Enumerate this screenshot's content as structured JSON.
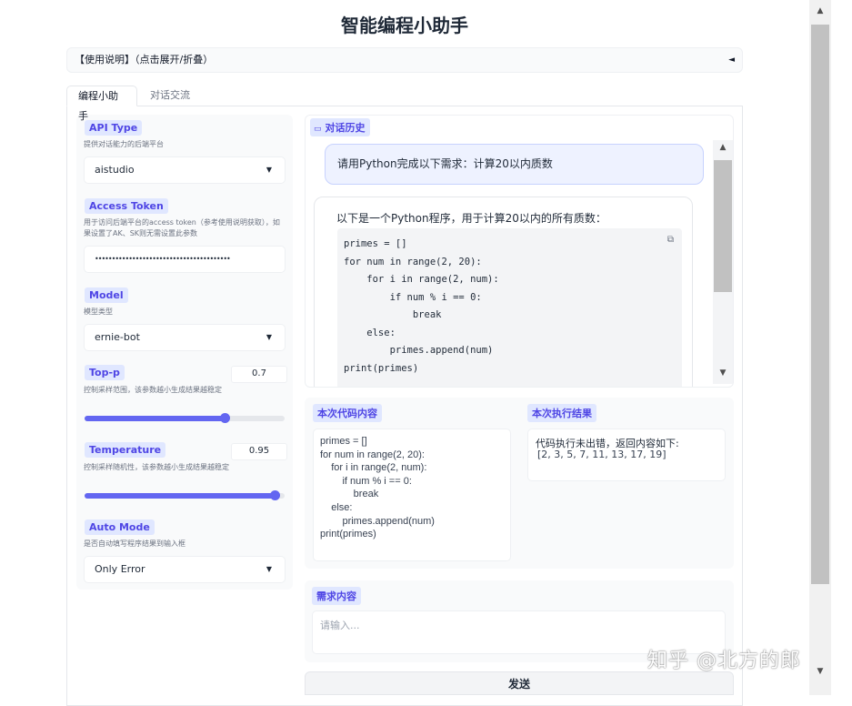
{
  "app": {
    "title": "智能编程小助手"
  },
  "instructions": {
    "label": "【使用说明】（点击展开/折叠）",
    "caret": "◄"
  },
  "tabs": [
    {
      "label": "编程小助手",
      "active": true
    },
    {
      "label": "对话交流",
      "active": false
    }
  ],
  "settings": {
    "api_type": {
      "label": "API Type",
      "hint": "提供对话能力的后端平台",
      "value": "aistudio"
    },
    "access_token": {
      "label": "Access Token",
      "hint": "用于访问后端平台的access token（参考使用说明获取），如果设置了AK、SK则无需设置此参数",
      "value": "••••••••••••••••••••••••••••••••••••••••"
    },
    "model": {
      "label": "Model",
      "hint": "模型类型",
      "value": "ernie-bot"
    },
    "top_p": {
      "label": "Top-p",
      "hint": "控制采样范围，该参数越小生成结果越稳定",
      "value": "0.7",
      "fraction": 0.7
    },
    "temperature": {
      "label": "Temperature",
      "hint": "控制采样随机性，该参数越小生成结果越稳定",
      "value": "0.95",
      "fraction": 0.95
    },
    "auto_mode": {
      "label": "Auto Mode",
      "hint": "是否自动填写程序结果到输入框",
      "value": "Only Error"
    }
  },
  "chat": {
    "label": "对话历史",
    "user_message": "请用Python完成以下需求：计算20以内质数",
    "bot_intro": "以下是一个Python程序，用于计算20以内的所有质数：",
    "code_lines": [
      "primes = []",
      "for num in range(2, 20):",
      "    for i in range(2, num):",
      "        if num % i == 0:",
      "            break",
      "    else:",
      "        primes.append(num)",
      "print(primes)"
    ]
  },
  "code_content": {
    "label": "本次代码内容",
    "text": "primes = []\nfor num in range(2, 20):\n    for i in range(2, num):\n        if num % i == 0:\n            break\n    else:\n        primes.append(num)\nprint(primes)"
  },
  "exec_result": {
    "label": "本次执行结果",
    "line1": "代码执行未出错，返回内容如下:",
    "line2": "[2, 3, 5, 7, 11, 13, 17, 19]"
  },
  "request": {
    "label": "需求内容",
    "placeholder": "请输入..."
  },
  "send": {
    "label": "发送"
  },
  "watermark": "知乎 @北方的郎",
  "icons": {
    "copy": "copy-icon",
    "chat": "chat-bubble-icon",
    "dropdown": "dropdown-arrow-icon"
  },
  "colors": {
    "accent": "#6366f1",
    "label_bg": "#e0e7ff",
    "label_text": "#4f46e5"
  }
}
